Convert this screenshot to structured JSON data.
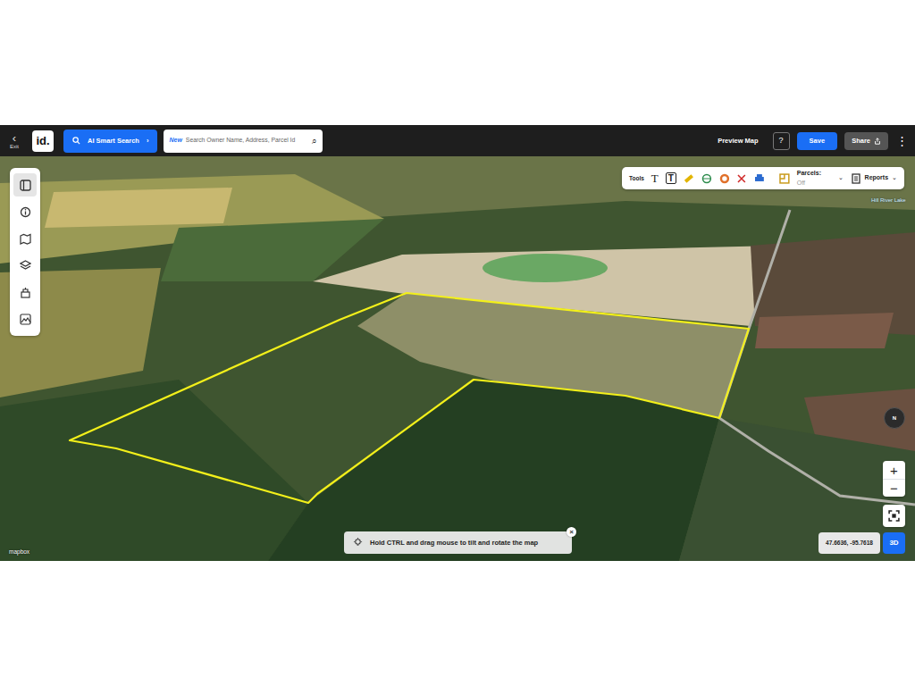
{
  "app": {
    "exit_arrow": "‹",
    "exit_label": "Exit",
    "logo": "id.",
    "ai_search": "AI Smart Search",
    "ai_chevron": "›",
    "search": {
      "badge": "New",
      "placeholder": "Search Owner Name, Address, Parcel Id",
      "icon": "⌕"
    },
    "preview": "Preview Map",
    "help": "?",
    "save": "Save",
    "share": "Share",
    "more": "⋮"
  },
  "sidebar": {
    "items": [
      {
        "selected": true
      },
      {
        "selected": false
      },
      {
        "selected": false
      },
      {
        "selected": false
      },
      {
        "selected": false
      },
      {
        "selected": false
      }
    ]
  },
  "toolbar": {
    "label": "Tools",
    "text_tool": "T",
    "textbox_tool": "T",
    "parcels_label": "Parcels:",
    "parcels_value": "Off",
    "parcels_caret": "⌄",
    "reports": "Reports",
    "reports_caret": "⌄"
  },
  "map": {
    "labels": [
      {
        "text": "Hill River Lake"
      }
    ],
    "compass": "N",
    "zoom_in": "+",
    "zoom_out": "−",
    "coordinates": "47.6636, -95.7618",
    "mode": "3D",
    "hint": "Hold CTRL and drag mouse to tilt and rotate the map",
    "hint_close": "×",
    "attribution": "mapbox"
  }
}
